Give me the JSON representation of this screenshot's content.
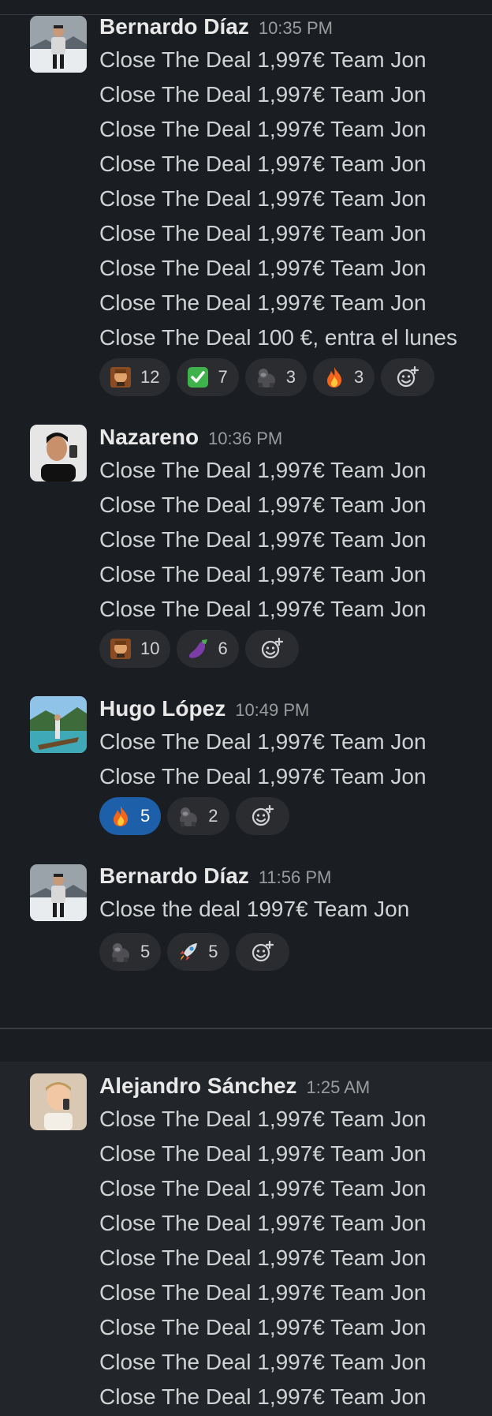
{
  "messages": [
    {
      "author": "Bernardo Díaz",
      "time": "10:35 PM",
      "lines": [
        "Close The Deal 1,997€ Team Jon",
        "Close The Deal 1,997€ Team Jon",
        "Close The Deal 1,997€ Team Jon",
        "Close The Deal 1,997€ Team Jon",
        "Close The Deal 1,997€ Team Jon",
        "Close The Deal 1,997€ Team Jon",
        "Close The Deal 1,997€ Team Jon",
        "Close The Deal 1,997€ Team Jon",
        "Close The Deal 100 €, entra el lunes"
      ],
      "reactions": [
        {
          "icon": "leo-face-emoji",
          "count": "12"
        },
        {
          "icon": "check-mark-emoji",
          "count": "7"
        },
        {
          "icon": "gorilla-emoji",
          "count": "3"
        },
        {
          "icon": "fire-emoji",
          "count": "3"
        }
      ]
    },
    {
      "author": "Nazareno",
      "time": "10:36 PM",
      "lines": [
        "Close The Deal 1,997€ Team Jon",
        "Close The Deal 1,997€ Team Jon",
        "Close The Deal 1,997€ Team Jon",
        "Close The Deal 1,997€ Team Jon",
        "Close The Deal 1,997€ Team Jon"
      ],
      "reactions": [
        {
          "icon": "leo-face-emoji",
          "count": "10"
        },
        {
          "icon": "eggplant-emoji",
          "count": "6"
        }
      ]
    },
    {
      "author": "Hugo López",
      "time": "10:49 PM",
      "lines": [
        "Close The Deal 1,997€ Team Jon",
        "Close The Deal 1,997€ Team Jon"
      ],
      "reactions": [
        {
          "icon": "fire-emoji",
          "count": "5",
          "active": true
        },
        {
          "icon": "gorilla-emoji",
          "count": "2"
        }
      ]
    },
    {
      "author": "Bernardo Díaz",
      "time": "11:56 PM",
      "lines": [
        "Close the deal 1997€ Team Jon"
      ],
      "reactions": [
        {
          "icon": "gorilla-emoji",
          "count": "5"
        },
        {
          "icon": "rocket-emoji",
          "count": "5"
        }
      ]
    },
    {
      "author": "Alejandro Sánchez",
      "time": "1:25 AM",
      "lines": [
        "Close The Deal 1,997€ Team Jon",
        "Close The Deal 1,997€ Team Jon",
        "Close The Deal 1,997€ Team Jon",
        "Close The Deal 1,997€ Team Jon",
        "Close The Deal 1,997€ Team Jon",
        "Close The Deal 1,997€ Team Jon",
        "Close The Deal 1,997€ Team Jon",
        "Close The Deal 1,997€ Team Jon",
        "Close The Deal 1,997€ Team Jon"
      ],
      "reactions": []
    }
  ],
  "add_reaction_icon": "add-emoji-icon",
  "colors": {
    "background": "#1a1d21",
    "text": "#d1d2d3",
    "active_reaction": "#1d5fa8"
  }
}
